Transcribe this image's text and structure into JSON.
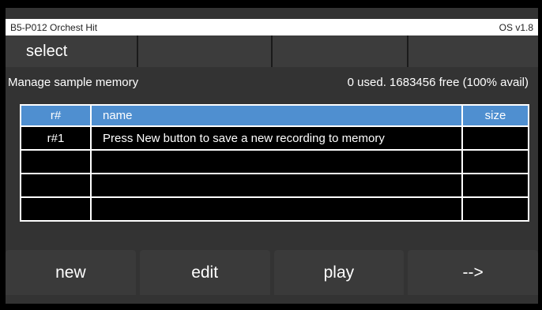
{
  "title_bar": {
    "preset": "B5-P012 Orchest Hit",
    "os": "OS v1.8"
  },
  "top_buttons": [
    {
      "label": "select"
    },
    {
      "label": ""
    },
    {
      "label": ""
    },
    {
      "label": ""
    }
  ],
  "info": {
    "heading": "Manage sample memory",
    "memory": "0 used. 1683456 free (100% avail)"
  },
  "table": {
    "headers": {
      "rnum": "r#",
      "name": "name",
      "size": "size"
    },
    "rows": [
      {
        "rnum": "r#1",
        "name": "Press New button to save a new recording to memory",
        "size": ""
      },
      {
        "rnum": "",
        "name": "",
        "size": ""
      },
      {
        "rnum": "",
        "name": "",
        "size": ""
      },
      {
        "rnum": "",
        "name": "",
        "size": ""
      }
    ]
  },
  "bottom_buttons": [
    {
      "label": "new"
    },
    {
      "label": "edit"
    },
    {
      "label": "play"
    },
    {
      "label": "-->"
    }
  ]
}
